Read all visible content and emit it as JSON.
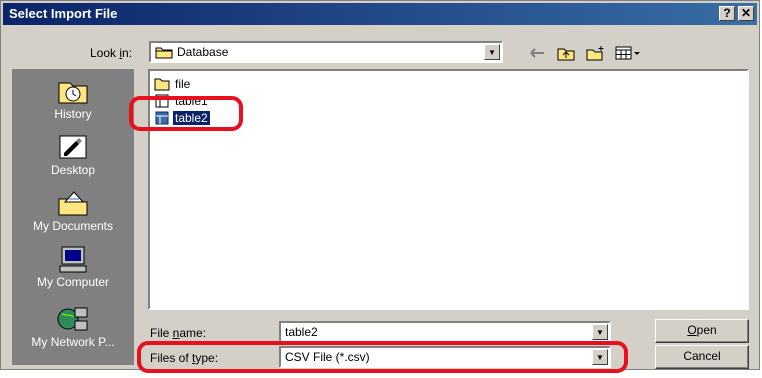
{
  "window": {
    "title": "Select Import File",
    "help_label": "?",
    "close_label": "✕"
  },
  "look_in": {
    "label_pre": "Look ",
    "label_key": "i",
    "label_post": "n:",
    "value": "Database"
  },
  "toolbar": {
    "icons": [
      "back-arrow-icon",
      "up-folder-icon",
      "new-folder-icon",
      "view-menu-icon"
    ]
  },
  "places": [
    {
      "label": "History",
      "icon": "history-icon"
    },
    {
      "label": "Desktop",
      "icon": "desktop-icon"
    },
    {
      "label": "My Documents",
      "icon": "my-documents-icon"
    },
    {
      "label": "My Computer",
      "icon": "my-computer-icon"
    },
    {
      "label": "My Network P...",
      "icon": "my-network-icon"
    }
  ],
  "files": [
    {
      "name": "file",
      "type": "folder",
      "selected": false
    },
    {
      "name": "table1",
      "type": "file",
      "selected": false
    },
    {
      "name": "table2",
      "type": "file",
      "selected": true
    }
  ],
  "file_name": {
    "label_pre": "File ",
    "label_key": "n",
    "label_post": "ame:",
    "value": "table2"
  },
  "file_type": {
    "label_pre": "Files of ",
    "label_key": "t",
    "label_post": "ype:",
    "value": "CSV File (*.csv)"
  },
  "buttons": {
    "open_key": "O",
    "open_rest": "pen",
    "cancel": "Cancel"
  },
  "colors": {
    "title_bar": "#0a246a",
    "selection": "#0a246a",
    "highlight_ring": "#e8101f"
  }
}
